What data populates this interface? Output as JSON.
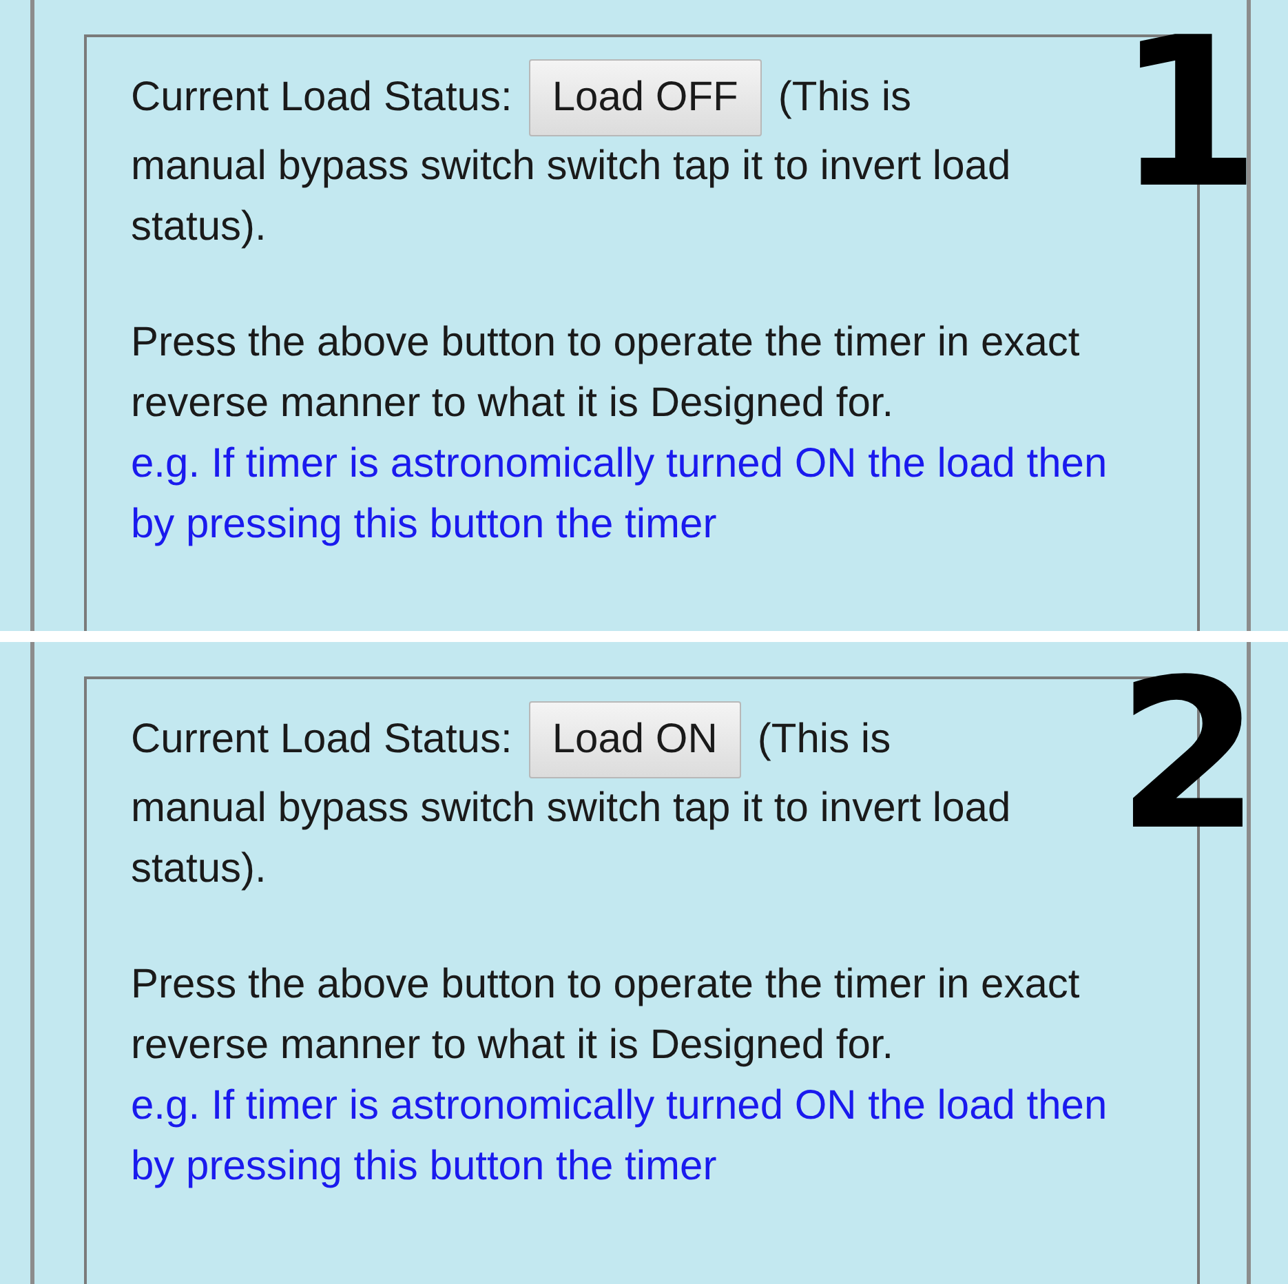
{
  "panels": [
    {
      "badge": "1",
      "status_label": "Current Load Status:",
      "button": {
        "label": "Load OFF"
      },
      "note_start": "(This is",
      "note_rest": "manual bypass switch switch tap it to invert load status).",
      "paragraph": "Press the above button to operate the timer in exact reverse manner to what it is Designed for.",
      "example": "e.g. If timer is astronomically turned ON the load then by pressing this button the timer"
    },
    {
      "badge": "2",
      "status_label": "Current Load Status:",
      "button": {
        "label": "Load ON"
      },
      "note_start": "(This is",
      "note_rest": "manual bypass switch switch tap it to invert load status).",
      "paragraph": "Press the above button to operate the timer in exact reverse manner to what it is Designed for.",
      "example": "e.g. If timer is astronomically turned ON the load then by pressing this button the timer"
    }
  ]
}
